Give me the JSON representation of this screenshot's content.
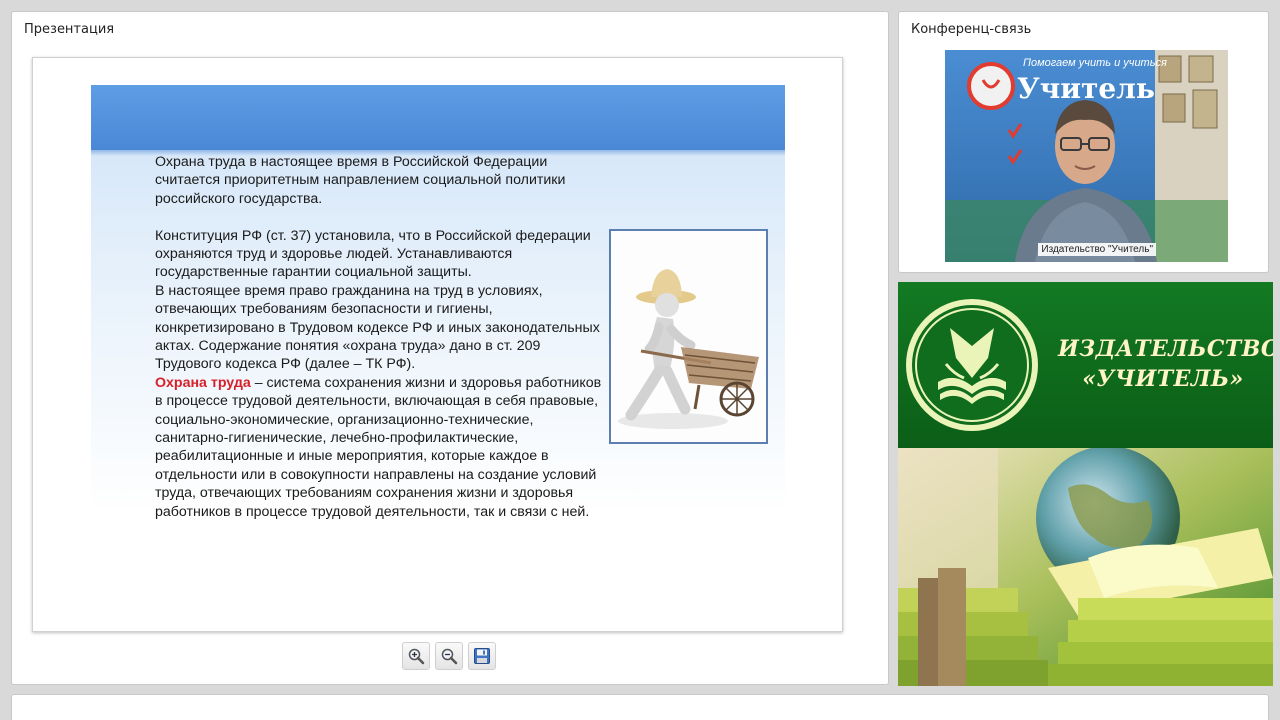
{
  "presentation": {
    "title": "Презентация",
    "slide": {
      "p1": "Охрана труда в настоящее время в Российской Федерации считается приоритетным направлением социальной политики российского государства.",
      "p2": "Конституция РФ (ст. 37) установила, что в Российской федерации охраняются труд и здоровье людей. Устанавливаются государственные гарантии социальной защиты.",
      "p3": "В настоящее время право гражданина на труд в условиях, отвечающих требованиям безопасности и гигиены, конкретизировано в Трудовом кодексе РФ и иных законодательных актах. Содержание понятия «охрана труда» дано в ст. 209 Трудового кодекса РФ (далее – ТК РФ).",
      "term": "Охрана труда",
      "definition": " – система сохранения жизни и здоровья работников в процессе трудовой деятельности, включающая в себя правовые, социально-экономические, организационно-технические, санитарно-гигиенические, лечебно-профилактические, реабилитационные и иные мероприятия, которые каждое в отдельности или в совокупности направлены на создание условий труда, отвечающих требованиям сохранения жизни и здоровья работников в процессе трудовой деятельности, так и связи с ней."
    },
    "toolbar": {
      "zoom_in_icon": "zoom-in-icon",
      "zoom_out_icon": "zoom-out-icon",
      "save_icon": "floppy-disk-icon"
    }
  },
  "conference": {
    "title": "Конференц-связь",
    "video_caption": "Издательство \"Учитель\"",
    "backdrop_line1": "Помогаем учить и учиться",
    "backdrop_brand": "Учитель"
  },
  "publisher": {
    "line1": "ИЗДАТЕЛЬСТВО",
    "line2": "«УЧИТЕЛЬ»"
  },
  "colors": {
    "slide_banner": "#4a88d6",
    "term_red": "#d8202a",
    "publisher_green": "#0f6d1d",
    "publisher_text": "#fff4c6"
  }
}
